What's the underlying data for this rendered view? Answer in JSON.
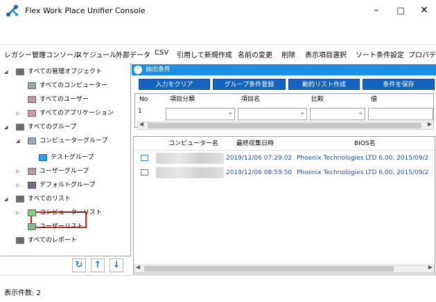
{
  "window": {
    "title": "Flex Work Place Unifier Console",
    "controls": [
      "–",
      "□",
      "✕"
    ]
  },
  "menu": [
    "レガシー管理コンソール",
    "スケジュール",
    "外部データ",
    "CSV",
    "引用して新規作成",
    "名前の変更",
    "削除",
    "表示項目選択",
    "ソート条件設定",
    "プロパティ"
  ],
  "tree": {
    "items": [
      {
        "label": "すべての管理オブジェクト"
      },
      {
        "label": "すべてのコンピューター"
      },
      {
        "label": "すべてのユーザー"
      },
      {
        "label": "すべてのアプリケーション"
      },
      {
        "label": "すべてのグループ"
      },
      {
        "label": "コンピューターグループ"
      },
      {
        "label": "テストグループ"
      },
      {
        "label": "ユーザーグループ"
      },
      {
        "label": "デフォルトグループ"
      },
      {
        "label": "すべてのリスト"
      },
      {
        "label": "コンピューターリスト"
      },
      {
        "label": "ユーザーリスト"
      },
      {
        "label": "すべてのレポート"
      }
    ],
    "footer_buttons": [
      "↻",
      "↑",
      "↓"
    ]
  },
  "filter": {
    "header": "抽出条件",
    "buttons": [
      "入力をクリア",
      "グループ条件登録",
      "動的リスト作成",
      "条件を保存"
    ],
    "columns": [
      "No",
      "項目分類",
      "項目名",
      "比較",
      "値"
    ],
    "row_no": "1"
  },
  "results": {
    "columns": [
      "コンピューター名",
      "最終収集日時",
      "BIOS名"
    ],
    "rows": [
      {
        "name": "",
        "datetime": "2019/12/06 07:29:02",
        "bios": "Phoenix Technologies LTD 6.00, 2015/09/2"
      },
      {
        "name": "",
        "datetime": "2019/12/06 08:59:50",
        "bios": "Phoenix Technologies LTD 6.00, 2015/09/2"
      }
    ]
  },
  "status": {
    "count_label": "表示件数: 2"
  },
  "colors": {
    "accent": "#1a8ee0",
    "button": "#1565c0",
    "link_text": "#1f4e9c",
    "highlight": "#e01818"
  }
}
